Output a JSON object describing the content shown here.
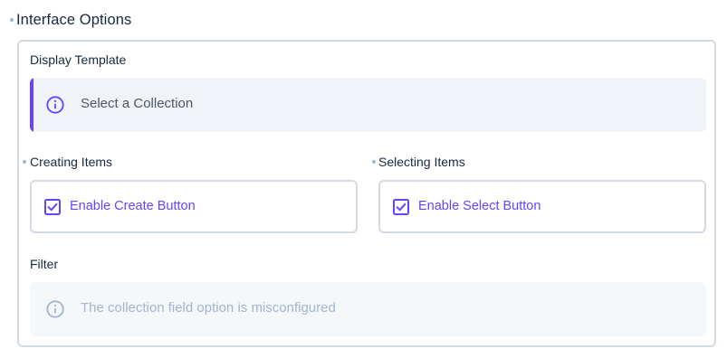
{
  "section": {
    "title": "Interface Options"
  },
  "display_template": {
    "label": "Display Template",
    "notice_text": "Select a Collection",
    "icon": "info-icon"
  },
  "creating_items": {
    "label": "Creating Items",
    "checkbox_label": "Enable Create Button",
    "checked": true,
    "icon": "checkbox-checked-icon"
  },
  "selecting_items": {
    "label": "Selecting Items",
    "checkbox_label": "Enable Select Button",
    "checked": true,
    "icon": "checkbox-checked-icon"
  },
  "filter": {
    "label": "Filter",
    "notice_text": "The collection field option is misconfigured",
    "icon": "info-icon"
  },
  "colors": {
    "accent": "#6644ff",
    "border": "#d3dae4",
    "notice_bg": "#f0f4f9",
    "muted_text": "#a2b5cd",
    "text": "#172940"
  }
}
